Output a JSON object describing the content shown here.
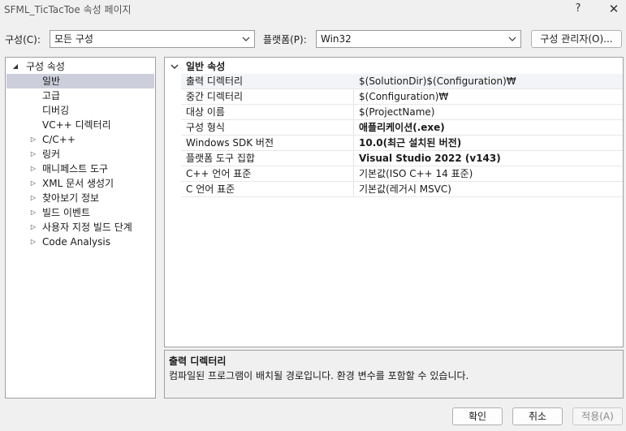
{
  "window": {
    "title": "SFML_TicTacToe 속성 페이지",
    "help_glyph": "?",
    "close_glyph": "✕"
  },
  "config": {
    "label": "구성(C):",
    "value": "모든 구성",
    "platform_label": "플랫폼(P):",
    "platform_value": "Win32",
    "manager_button": "구성 관리자(O)..."
  },
  "tree": {
    "items": [
      {
        "label": "구성 속성",
        "expander": "◢"
      },
      {
        "label": "일반",
        "expander": ""
      },
      {
        "label": "고급",
        "expander": ""
      },
      {
        "label": "디버깅",
        "expander": ""
      },
      {
        "label": "VC++ 디렉터리",
        "expander": ""
      },
      {
        "label": "C/C++",
        "expander": "▷"
      },
      {
        "label": "링커",
        "expander": "▷"
      },
      {
        "label": "매니페스트 도구",
        "expander": "▷"
      },
      {
        "label": "XML 문서 생성기",
        "expander": "▷"
      },
      {
        "label": "찾아보기 정보",
        "expander": "▷"
      },
      {
        "label": "빌드 이벤트",
        "expander": "▷"
      },
      {
        "label": "사용자 지정 빌드 단계",
        "expander": "▷"
      },
      {
        "label": "Code Analysis",
        "expander": "▷"
      }
    ]
  },
  "grid": {
    "category": "일반 속성",
    "rows": [
      {
        "name": "출력 디렉터리",
        "value": "$(SolutionDir)$(Configuration)₩"
      },
      {
        "name": "중간 디렉터리",
        "value": "$(Configuration)₩"
      },
      {
        "name": "대상 이름",
        "value": "$(ProjectName)"
      },
      {
        "name": "구성 형식",
        "value": "애플리케이션(.exe)"
      },
      {
        "name": "Windows SDK 버전",
        "value": "10.0(최근 설치된 버전)"
      },
      {
        "name": "플랫폼 도구 집합",
        "value": "Visual Studio 2022 (v143)"
      },
      {
        "name": "C++ 언어 표준",
        "value": "기본값(ISO C++ 14 표준)"
      },
      {
        "name": "C 언어 표준",
        "value": "기본값(레거시 MSVC)"
      }
    ]
  },
  "description": {
    "title": "출력 디렉터리",
    "text": "컴파일된 프로그램이 배치될 경로입니다. 환경 변수를 포함할 수 있습니다."
  },
  "buttons": {
    "ok": "확인",
    "cancel": "취소",
    "apply": "적용(A)"
  }
}
